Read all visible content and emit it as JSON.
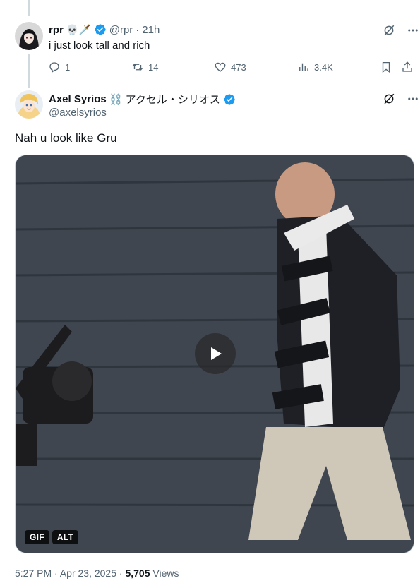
{
  "reply_tweet": {
    "display_name": "rpr",
    "name_emojis": "💀🗡️",
    "handle": "@rpr",
    "separator": "·",
    "time": "21h",
    "text": "i just look tall and rich",
    "stats": {
      "replies": "1",
      "retweets": "14",
      "likes": "473",
      "views": "3.4K"
    }
  },
  "main_tweet": {
    "display_name": "Axel Syrios",
    "name_suffix": "⛓️ アクセル・シリオス",
    "handle": "@axelsyrios",
    "text": "Nah u look like Gru",
    "media": {
      "type": "gif",
      "badges": [
        "GIF",
        "ALT"
      ]
    },
    "meta": {
      "time": "5:27 PM",
      "separator1": "·",
      "date": "Apr 23, 2025",
      "separator2": "·",
      "views_count": "5,705",
      "views_label": "Views"
    }
  },
  "colors": {
    "verified": "#1d9bf0",
    "secondary_text": "#536471",
    "primary_text": "#0f1419"
  }
}
